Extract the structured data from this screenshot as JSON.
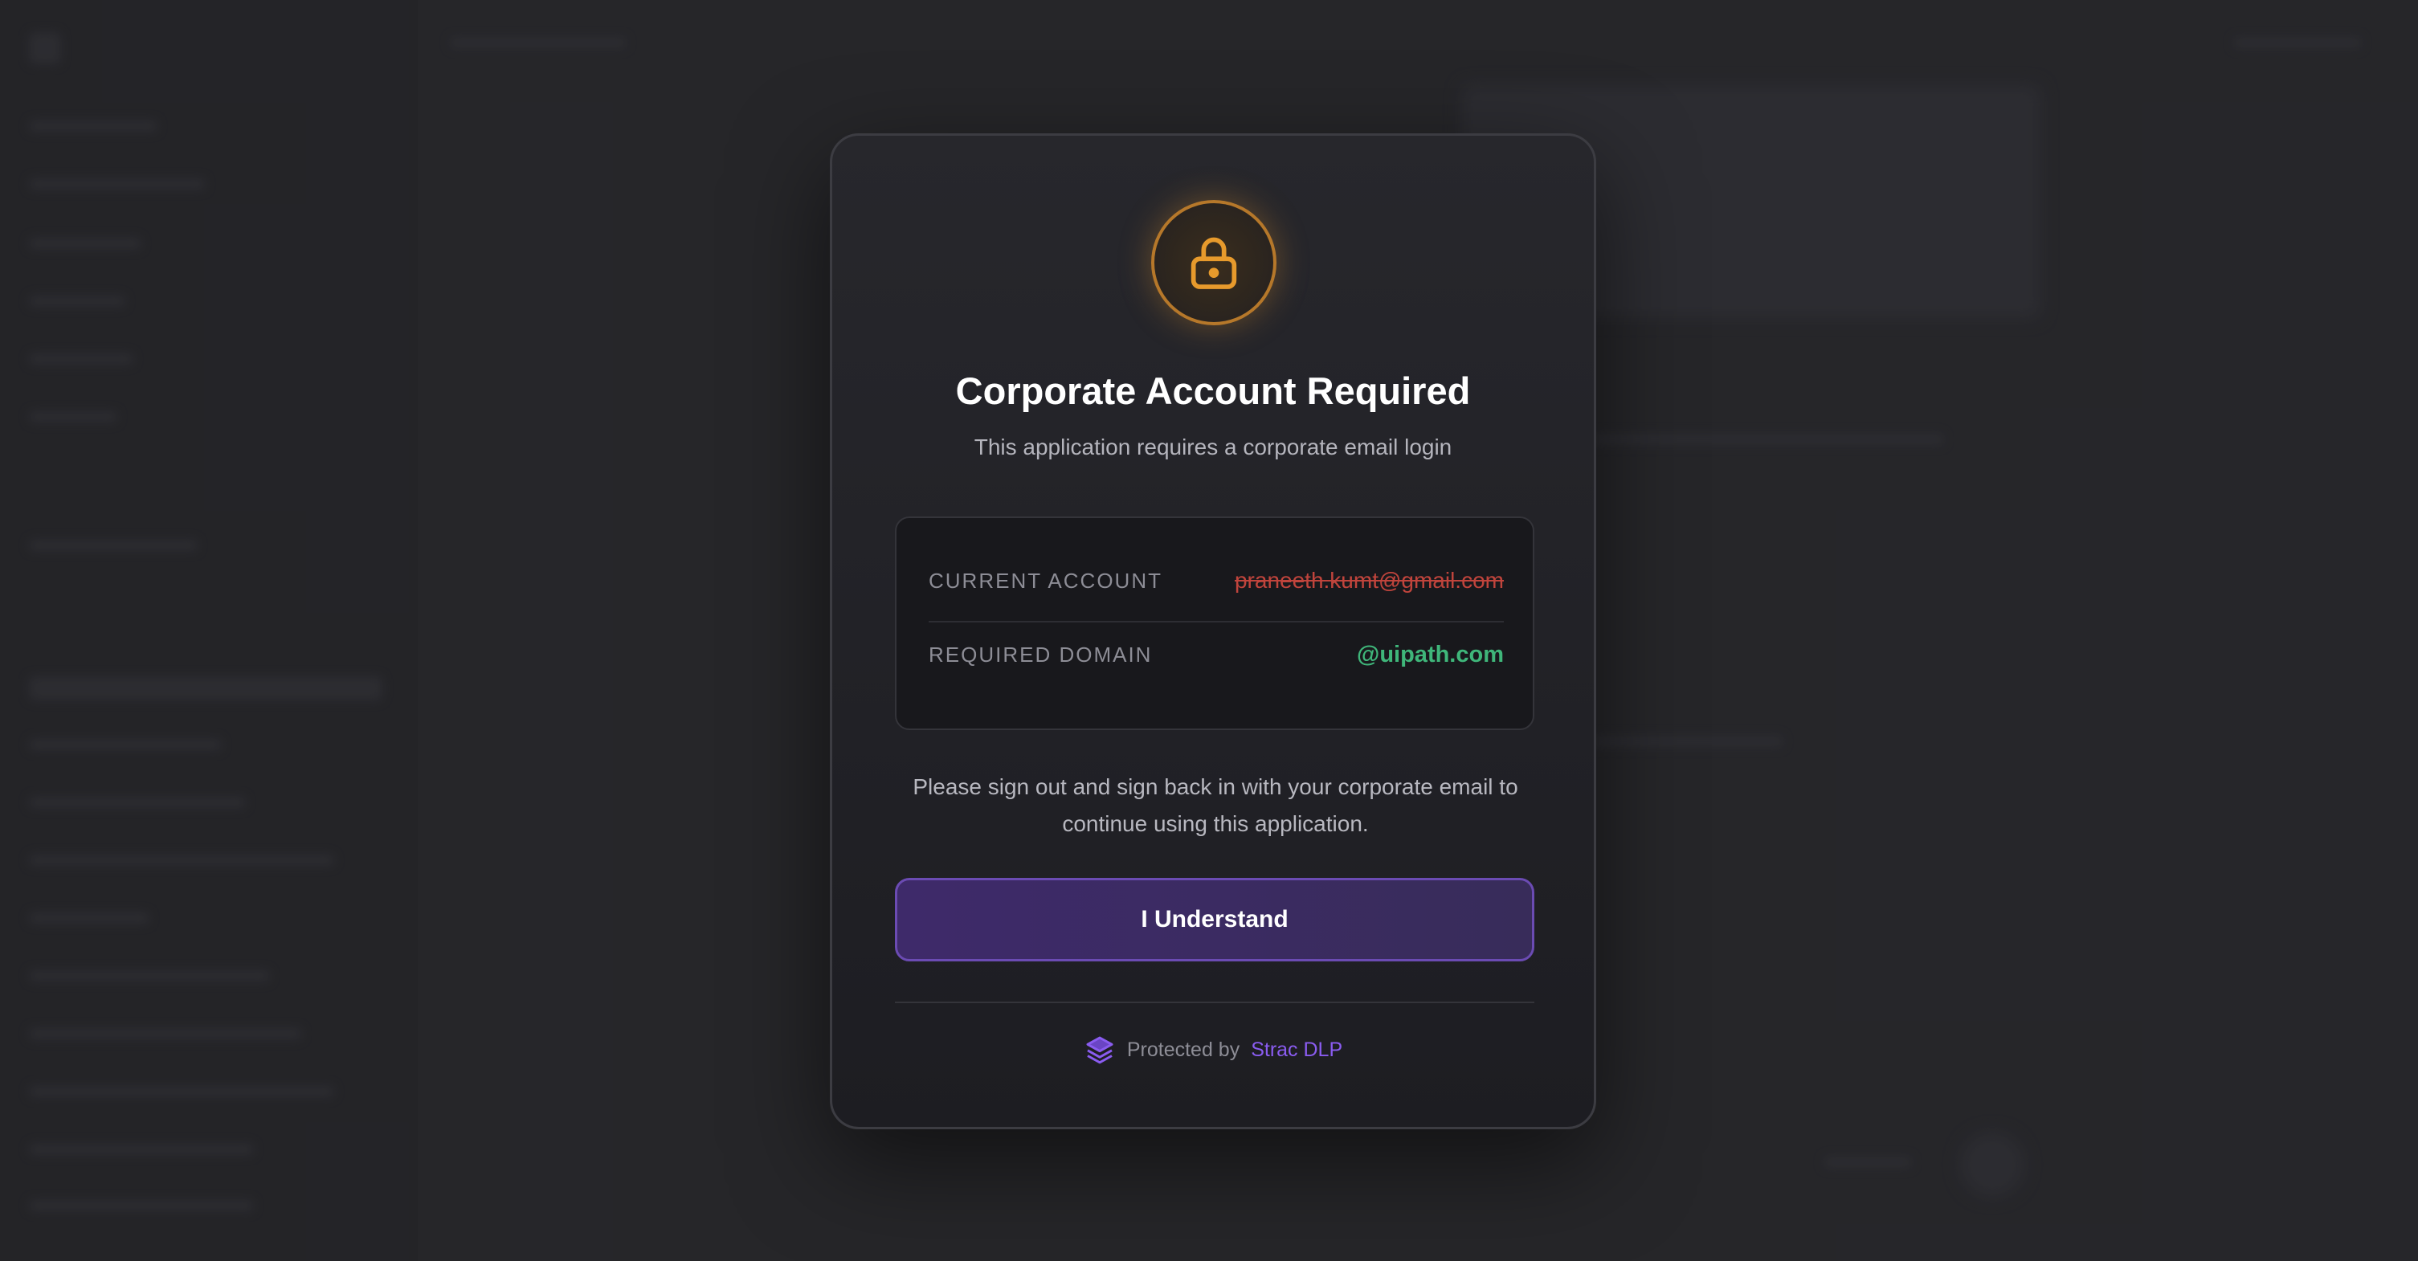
{
  "modal": {
    "title": "Corporate Account Required",
    "subtitle": "This application requires a corporate email login",
    "icon": "lock-icon",
    "accent_color": "#e79a2c",
    "current_account_label": "CURRENT ACCOUNT",
    "current_account_value": "praneeth.kumt@gmail.com",
    "required_domain_label": "REQUIRED DOMAIN",
    "required_domain_value": "@uipath.com",
    "message": "Please sign out and sign back in with your corporate email to continue using this application.",
    "button_label": "I Understand",
    "footer_text": "Protected by",
    "footer_link": "Strac DLP",
    "footer_icon": "layers-icon",
    "error_color": "#c0443c",
    "success_color": "#3fb67a",
    "brand_color": "#8a5cf0"
  }
}
